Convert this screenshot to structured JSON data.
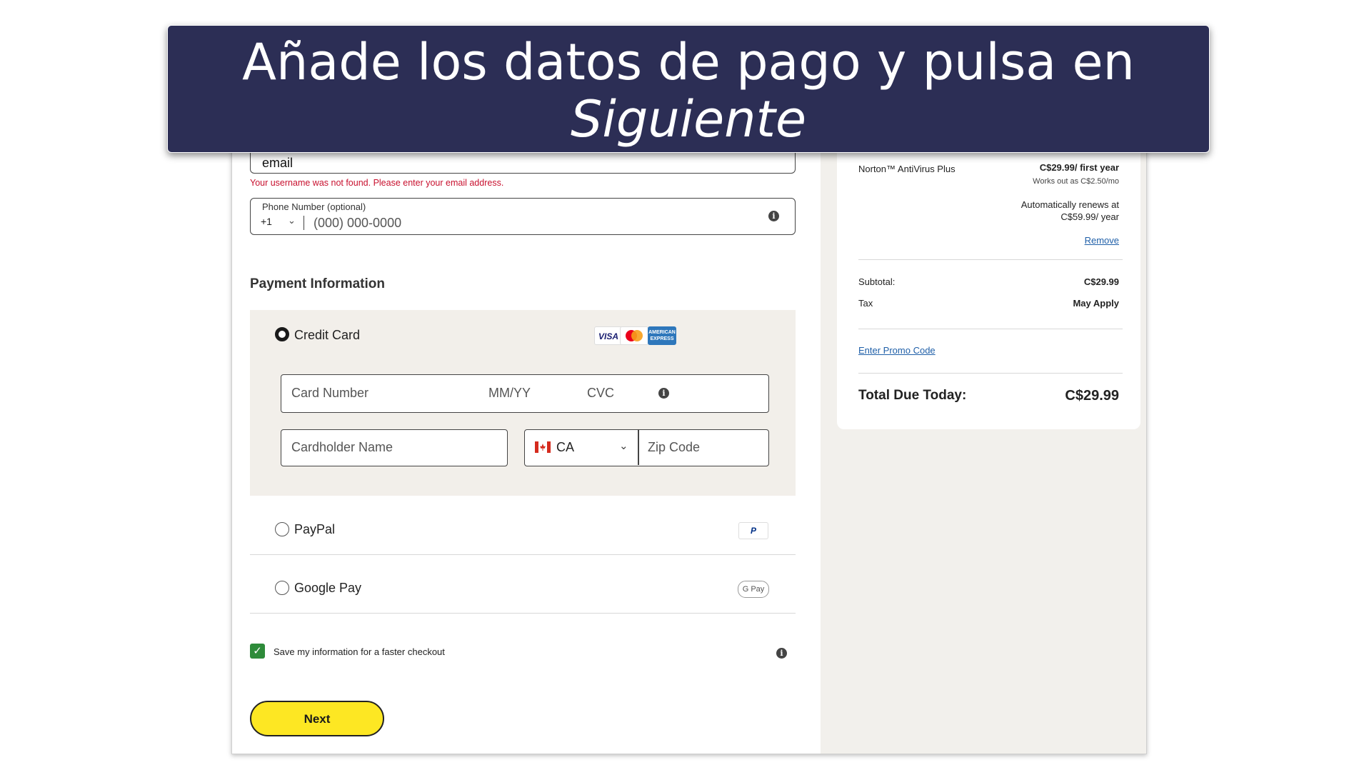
{
  "banner": {
    "line1": "Añade los datos de pago y pulsa en",
    "line2": "Siguiente"
  },
  "form": {
    "email_value": "email",
    "email_error": "Your username was not found. Please enter your email address.",
    "phone": {
      "label": "Phone Number (optional)",
      "country_code": "+1",
      "placeholder": "(000) 000-0000",
      "info_icon": "info-icon"
    }
  },
  "payment": {
    "heading": "Payment Information",
    "credit_card": {
      "label": "Credit Card",
      "selected": true,
      "logos": [
        "VISA",
        "mastercard",
        "AMERICAN EXPRESS"
      ],
      "card_number_placeholder": "Card Number",
      "expiry_placeholder": "MM/YY",
      "cvc_placeholder": "CVC",
      "cardholder_placeholder": "Cardholder Name",
      "country": "CA",
      "country_flag": "flag-canada-icon",
      "zip_placeholder": "Zip Code"
    },
    "paypal": {
      "label": "PayPal",
      "logo_text": "P"
    },
    "google_pay": {
      "label": "Google Pay",
      "logo_text": "G Pay"
    },
    "save_info": {
      "label": "Save my information for a faster checkout",
      "checked": true
    },
    "next_button": "Next"
  },
  "summary": {
    "product": "Norton™ AntiVirus Plus",
    "price": "C$29.99/ first year",
    "monthly": "Works out as C$2.50/mo",
    "renew_line1": "Automatically renews at",
    "renew_line2": "C$59.99/ year",
    "remove": "Remove",
    "subtotal_label": "Subtotal:",
    "subtotal_value": "C$29.99",
    "tax_label": "Tax",
    "tax_value": "May Apply",
    "promo": "Enter Promo Code",
    "total_label": "Total Due Today:",
    "total_value": "C$29.99"
  },
  "colors": {
    "banner_bg": "#2c2e55",
    "next_button_bg": "#fde723",
    "error_text": "#c8102e",
    "link": "#1f5fa8",
    "checkbox": "#2e8b3a",
    "panel_bg": "#f2efea"
  }
}
